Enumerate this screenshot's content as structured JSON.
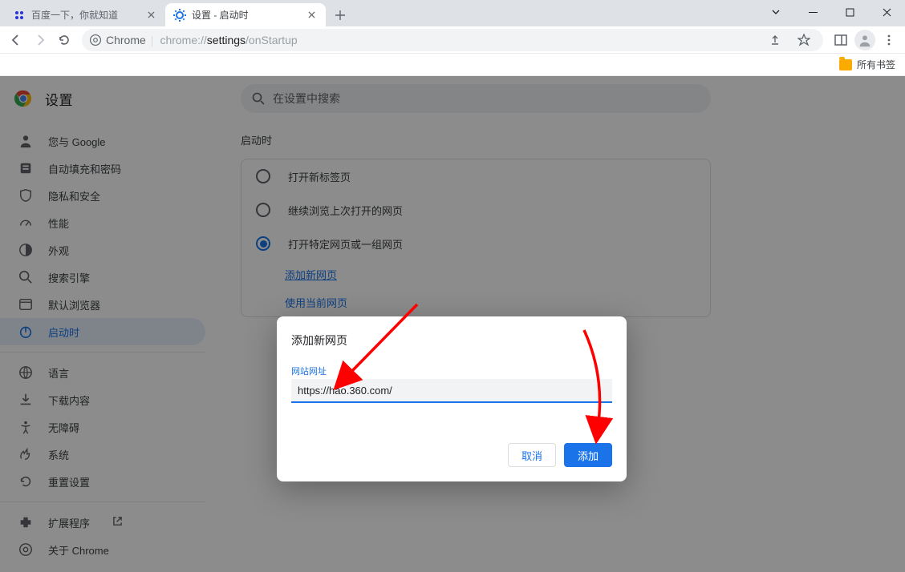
{
  "window": {
    "tabs": [
      {
        "title": "百度一下，你就知道",
        "active": false
      },
      {
        "title": "设置 - 启动时",
        "active": true
      }
    ]
  },
  "omnibox": {
    "scheme_label": "Chrome",
    "url_display": "chrome://settings/onStartup"
  },
  "bookmarks_bar": {
    "all_bookmarks_label": "所有书签"
  },
  "settings": {
    "title": "设置",
    "search_placeholder": "在设置中搜索",
    "sidebar": [
      {
        "icon": "person",
        "label": "您与 Google"
      },
      {
        "icon": "autofill",
        "label": "自动填充和密码"
      },
      {
        "icon": "shield",
        "label": "隐私和安全"
      },
      {
        "icon": "performance",
        "label": "性能"
      },
      {
        "icon": "appearance",
        "label": "外观"
      },
      {
        "icon": "search",
        "label": "搜索引擎"
      },
      {
        "icon": "browser",
        "label": "默认浏览器"
      },
      {
        "icon": "power",
        "label": "启动时",
        "active": true
      }
    ],
    "sidebar2": [
      {
        "icon": "globe",
        "label": "语言"
      },
      {
        "icon": "download",
        "label": "下载内容"
      },
      {
        "icon": "accessibility",
        "label": "无障碍"
      },
      {
        "icon": "system",
        "label": "系统"
      },
      {
        "icon": "reset",
        "label": "重置设置"
      }
    ],
    "sidebar3": [
      {
        "icon": "extension",
        "label": "扩展程序",
        "external": true
      },
      {
        "icon": "about",
        "label": "关于 Chrome"
      }
    ]
  },
  "startup": {
    "section_title": "启动时",
    "options": [
      {
        "label": "打开新标签页",
        "selected": false
      },
      {
        "label": "继续浏览上次打开的网页",
        "selected": false
      },
      {
        "label": "打开特定网页或一组网页",
        "selected": true
      }
    ],
    "add_page_link": "添加新网页",
    "use_current_link": "使用当前网页"
  },
  "dialog": {
    "title": "添加新网页",
    "field_label": "网站网址",
    "url_value": "https://hao.360.com/",
    "cancel_label": "取消",
    "confirm_label": "添加"
  }
}
